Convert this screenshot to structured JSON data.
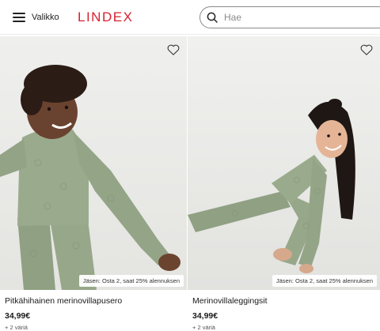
{
  "header": {
    "menu_label": "Valikko",
    "logo_text": "LINDEX",
    "search_placeholder": "Hae"
  },
  "colors": {
    "brand": "#d6202f",
    "product_green": "#97a88a"
  },
  "icons": {
    "menu": "hamburger-icon",
    "search": "search-icon",
    "favorite": "heart-outline-icon"
  },
  "products": [
    {
      "name": "Pitkähihainen merinovillapusero",
      "price": "34,99€",
      "colors": "+ 2 väriä",
      "badge": "Jäsen: Osta 2, saat 25% alennuksen"
    },
    {
      "name": "Merinovillaleggingsit",
      "price": "34,99€",
      "colors": "+ 2 väriä",
      "badge": "Jäsen: Osta 2, saat 25% alennuksen"
    }
  ]
}
